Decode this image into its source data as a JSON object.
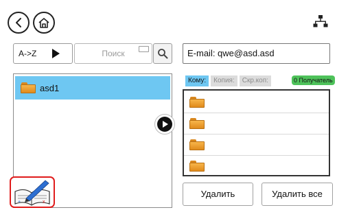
{
  "nav": {
    "back_icon": "chevron-left-icon",
    "home_icon": "home-icon",
    "network_icon": "network-icon"
  },
  "toolbar": {
    "sort_label": "A->Z",
    "search_placeholder": "Поиск"
  },
  "email": {
    "value": "E-mail: qwe@asd.asd"
  },
  "left_list": {
    "items": [
      {
        "label": "asd1",
        "selected": true
      }
    ]
  },
  "recipients": {
    "tabs": [
      {
        "label": "Кому:",
        "active": true
      },
      {
        "label": "Копия:",
        "active": false
      },
      {
        "label": "Скр.коп:",
        "active": false
      }
    ],
    "badge": "0 Получатель",
    "rows": 4
  },
  "actions": {
    "delete_label": "Удалить",
    "delete_all_label": "Удалить все"
  },
  "colors": {
    "selection": "#6ec7f2",
    "badge": "#4ec25a",
    "addr_book_border": "#e01b1b",
    "folder": "#f0a531"
  }
}
